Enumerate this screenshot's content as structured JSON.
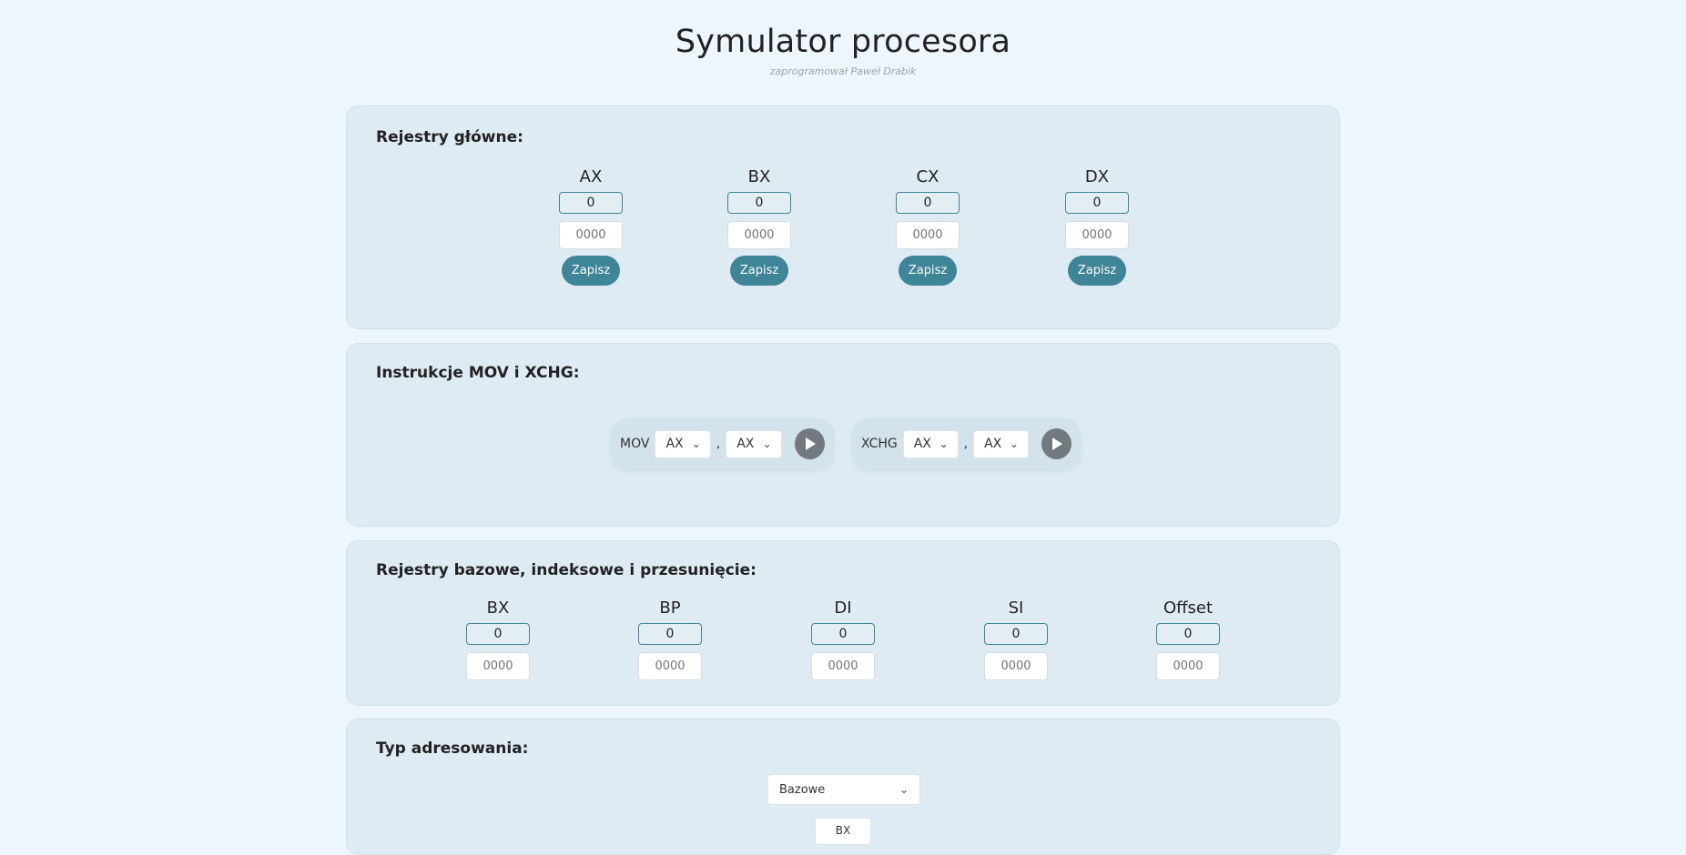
{
  "header": {
    "title": "Symulator procesora",
    "subtitle": "zaprogramował Paweł Drabik"
  },
  "main_registers": {
    "title": "Rejestry główne:",
    "save_label": "Zapisz",
    "items": [
      {
        "name": "AX",
        "dec": "0",
        "hex": "0000"
      },
      {
        "name": "BX",
        "dec": "0",
        "hex": "0000"
      },
      {
        "name": "CX",
        "dec": "0",
        "hex": "0000"
      },
      {
        "name": "DX",
        "dec": "0",
        "hex": "0000"
      }
    ]
  },
  "instructions": {
    "title": "Instrukcje MOV i XCHG:",
    "mov": {
      "label": "MOV",
      "src": "AX",
      "dst": "AX",
      "separator": ","
    },
    "xchg": {
      "label": "XCHG",
      "src": "AX",
      "dst": "AX",
      "separator": ","
    }
  },
  "base_registers": {
    "title": "Rejestry bazowe, indeksowe i przesunięcie:",
    "items": [
      {
        "name": "BX",
        "dec": "0",
        "hex": "0000"
      },
      {
        "name": "BP",
        "dec": "0",
        "hex": "0000"
      },
      {
        "name": "DI",
        "dec": "0",
        "hex": "0000"
      },
      {
        "name": "SI",
        "dec": "0",
        "hex": "0000"
      },
      {
        "name": "Offset",
        "dec": "0",
        "hex": "0000"
      }
    ]
  },
  "addressing": {
    "title": "Typ adresowania:",
    "selected": "Bazowe",
    "sub_selected": "BX"
  },
  "colors": {
    "background": "#eef6fd",
    "card": "#deebf3",
    "accent": "#3d8597",
    "run_button": "#727a80"
  }
}
